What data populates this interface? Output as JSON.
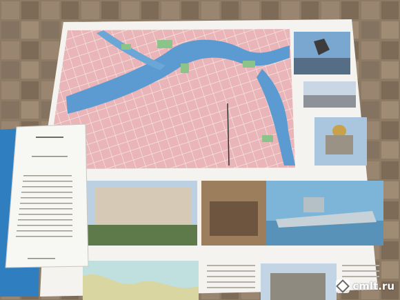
{
  "watermark": {
    "text": "cmlt.ru"
  }
}
